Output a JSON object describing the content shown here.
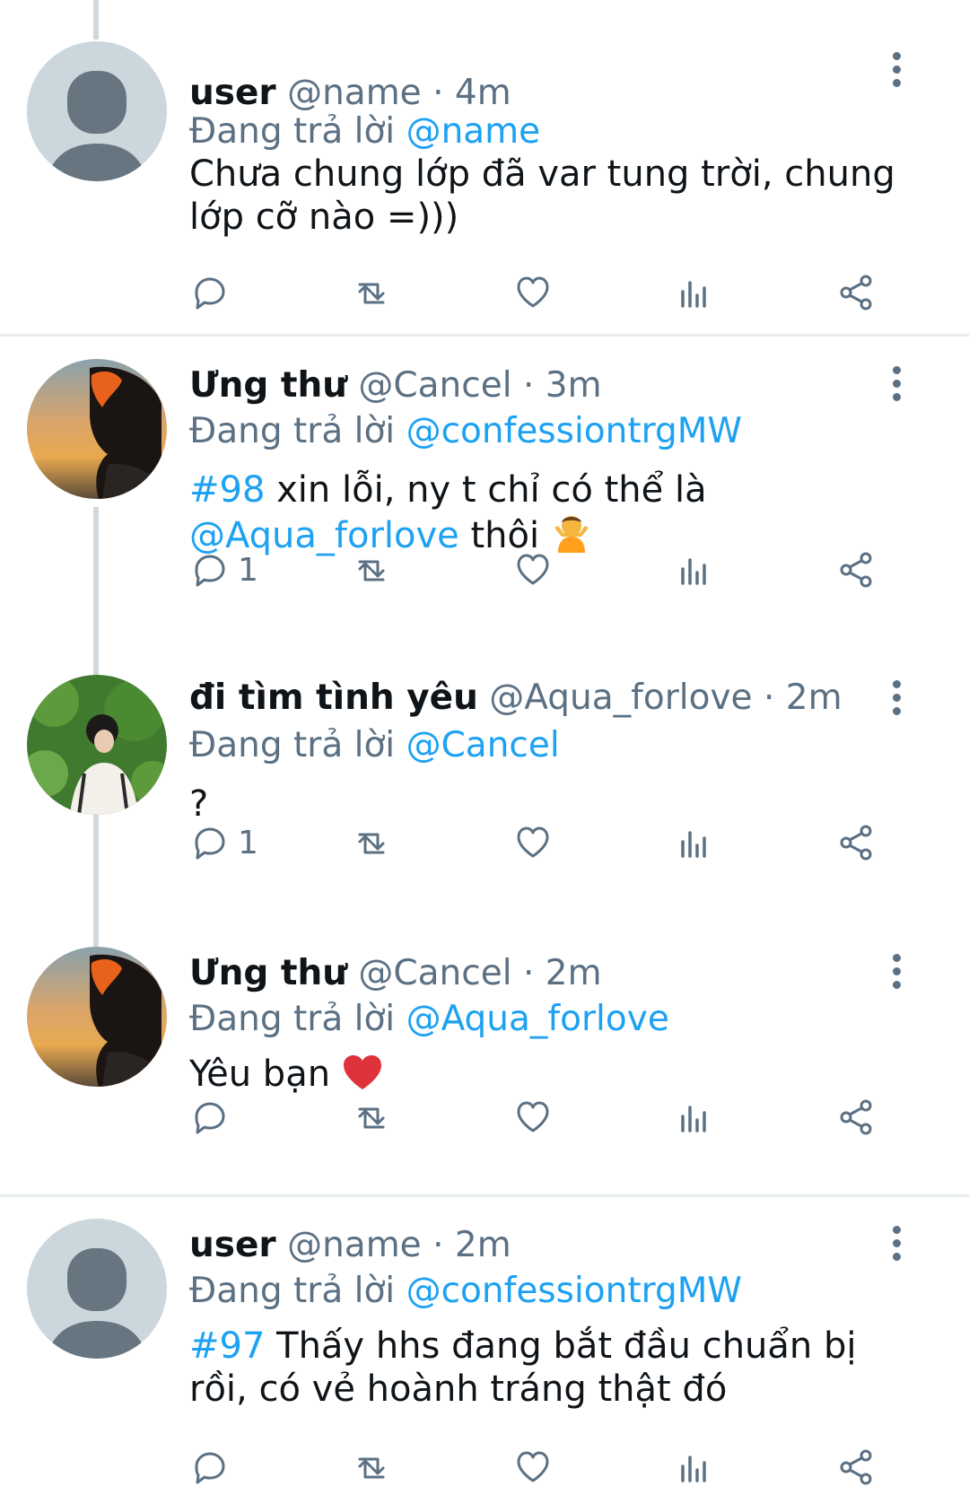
{
  "reply_prefix": "Đang trả lời",
  "tweets": [
    {
      "name": "user",
      "handle": "@name",
      "dot": "·",
      "time": "4m",
      "reply_to": "@name",
      "text": "Chưa chung lớp đã var tung trời, chung lớp cỡ nào =)))",
      "avatar": "default-avatar-icon",
      "reply_count": ""
    },
    {
      "name": "Ưng thư",
      "handle": "@Cancel",
      "dot": "·",
      "time": "3m",
      "reply_to": "@confessiontrgMW",
      "hashtag": "#98",
      "text_a": " xin lỗi, ny t chỉ có thể là",
      "mention": "@Aqua_forlove",
      "text_b": " thôi",
      "emoji": "person-shrugging-emoji",
      "avatar": "sunset-portrait-avatar",
      "reply_count": "1"
    },
    {
      "name": "đi tìm tình yêu",
      "handle": "@Aqua_forlove",
      "dot": "·",
      "time": "2m",
      "reply_to": "@Cancel",
      "text": "?",
      "avatar": "green-leaves-portrait-avatar",
      "reply_count": "1"
    },
    {
      "name": "Ưng thư",
      "handle": "@Cancel",
      "dot": "·",
      "time": "2m",
      "reply_to": "@Aqua_forlove",
      "text": "Yêu bạn",
      "emoji": "red-heart-emoji",
      "avatar": "sunset-portrait-avatar",
      "reply_count": ""
    },
    {
      "name": "user",
      "handle": "@name",
      "dot": "·",
      "time": "2m",
      "reply_to": "@confessiontrgMW",
      "hashtag": "#97",
      "text": " Thấy hhs đang bắt đầu chuẩn bị rồi, có vẻ hoành tráng thật đó",
      "avatar": "default-avatar-icon",
      "reply_count": ""
    }
  ],
  "colors": {
    "link": "#1da1f2",
    "secondary": "#5b7083",
    "divider": "#e6ecf0",
    "thread": "#cfd9de"
  }
}
